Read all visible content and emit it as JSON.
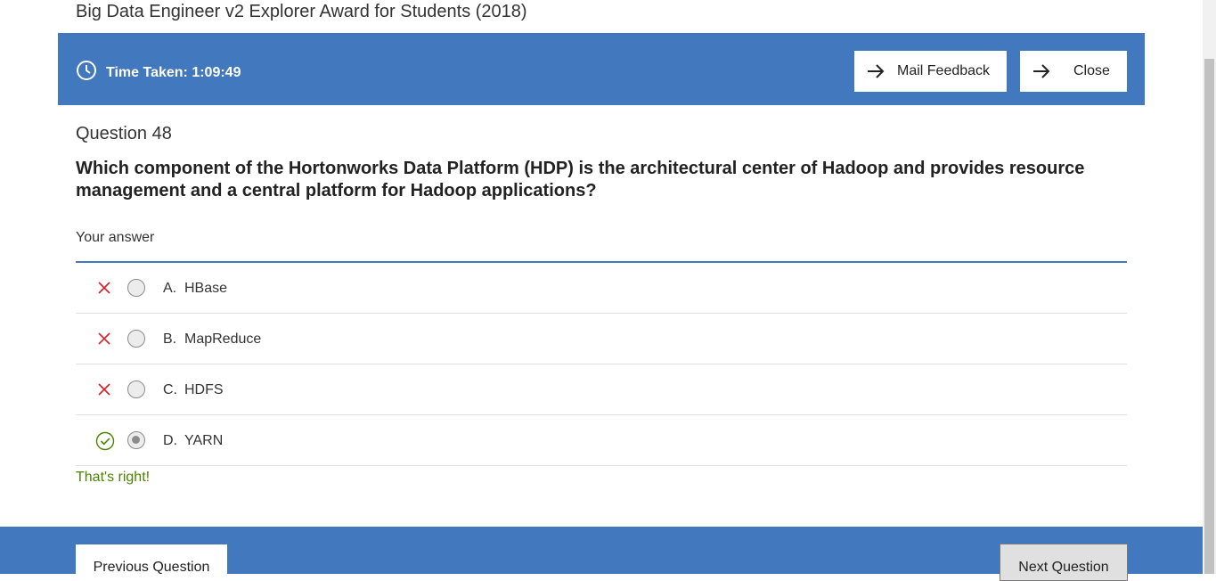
{
  "page": {
    "title": "Big Data Engineer v2 Explorer Award for Students (2018)"
  },
  "topbar": {
    "time_label": "Time Taken: 1:09:49",
    "mail_feedback_label": "Mail Feedback",
    "close_label": "Close",
    "accent_color": "#4178be"
  },
  "question": {
    "number_label": "Question 48",
    "text": "Which component of the Hortonworks Data Platform (HDP) is the architectural center of Hadoop and provides resource management and a central platform for Hadoop applications?",
    "your_answer_label": "Your answer",
    "options": [
      {
        "letter": "A.",
        "text": "HBase",
        "status": "incorrect",
        "selected": false
      },
      {
        "letter": "B.",
        "text": "MapReduce",
        "status": "incorrect",
        "selected": false
      },
      {
        "letter": "C.",
        "text": "HDFS",
        "status": "incorrect",
        "selected": false
      },
      {
        "letter": "D.",
        "text": "YARN",
        "status": "correct",
        "selected": true
      }
    ],
    "feedback": "That's right!",
    "feedback_color": "#4b8400"
  },
  "footer": {
    "prev_label": "Previous Question",
    "next_label": "Next Question"
  }
}
